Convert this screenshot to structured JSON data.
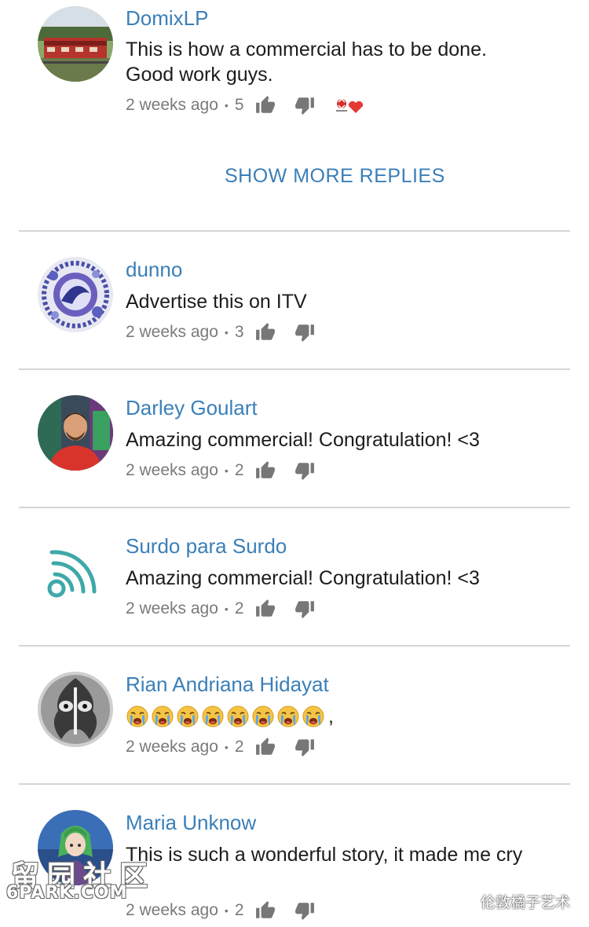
{
  "comments": [
    {
      "author": "DomixLP",
      "text": "This is how a commercial has to be done. Good work guys.",
      "time": "2 weeks ago",
      "likes": "5",
      "avatar": "train-photo-avatar"
    },
    {
      "author": "dunno",
      "text": "Advertise this on ITV",
      "time": "2 weeks ago",
      "likes": "3",
      "avatar": "blue-pattern-avatar"
    },
    {
      "author": "Darley Goulart",
      "text": "Amazing commercial! Congratulation! <3",
      "time": "2 weeks ago",
      "likes": "2",
      "avatar": "man-red-shirt-avatar"
    },
    {
      "author": "Surdo para Surdo",
      "text": "Amazing commercial! Congratulation! <3",
      "time": "2 weeks ago",
      "likes": "2",
      "avatar": "signal-waves-avatar"
    },
    {
      "author": "Rian Andriana Hidayat",
      "text": ",",
      "time": "2 weeks ago",
      "likes": "2",
      "avatar": "mono-symmetry-avatar",
      "emoji_count": 8,
      "emoji": "loudly-crying-face-emoji"
    },
    {
      "author": "Maria Unknow",
      "text": "This is such a wonderful story, it made me cry",
      "time": "2 weeks ago",
      "likes": "2",
      "avatar": "anime-avatar"
    }
  ],
  "show_more_label": "SHOW MORE REPLIES",
  "dot": "•",
  "creator_heart": "creator-heart-icon",
  "watermark": {
    "left_main": "留园社区",
    "left_sub": "6PARK.COM",
    "right": "伦敦橘子艺术"
  },
  "colors": {
    "link_blue": "#3b7fb8",
    "meta_gray": "#7a7a7a",
    "divider": "#d6d6d6",
    "heart_red": "#e53935"
  }
}
